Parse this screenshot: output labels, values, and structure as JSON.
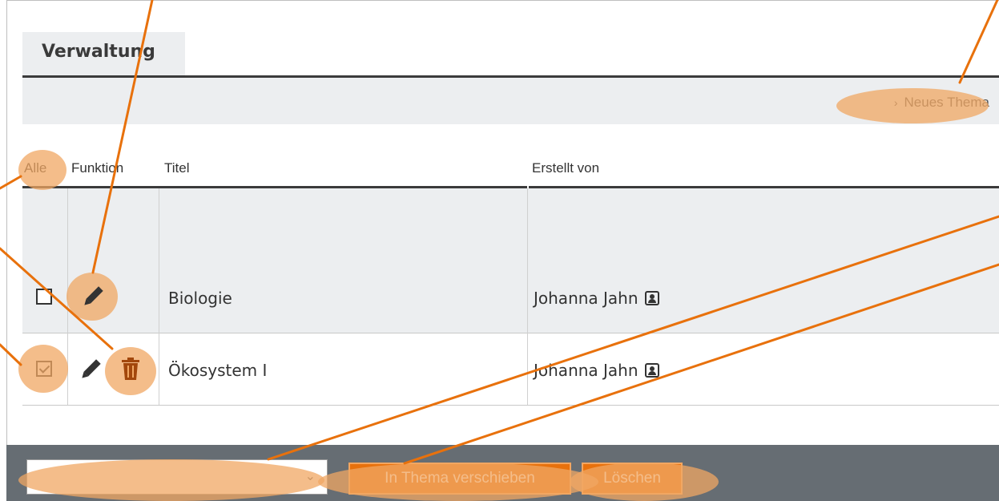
{
  "tab": {
    "label": "Verwaltung"
  },
  "toolbar": {
    "new_topic_label": "Neues Thema"
  },
  "table": {
    "headers": {
      "all": "Alle",
      "function": "Funktion",
      "title": "Titel",
      "created_by": "Erstellt von"
    },
    "rows": [
      {
        "title": "Biologie",
        "author": "Johanna Jahn",
        "checked": false
      },
      {
        "title": "Ökosystem I",
        "author": "Johanna Jahn",
        "checked": true
      }
    ]
  },
  "footer": {
    "topic_select": {
      "value": ""
    },
    "move_button": "In Thema verschieben",
    "delete_button": "Löschen"
  },
  "colors": {
    "accent": "#e8710c",
    "highlight": "#f0a763",
    "footer_bg": "#666d73"
  },
  "icons": [
    "pencil-icon",
    "trash-icon",
    "user-card-icon",
    "chevron-right-icon",
    "chevron-down-icon"
  ]
}
